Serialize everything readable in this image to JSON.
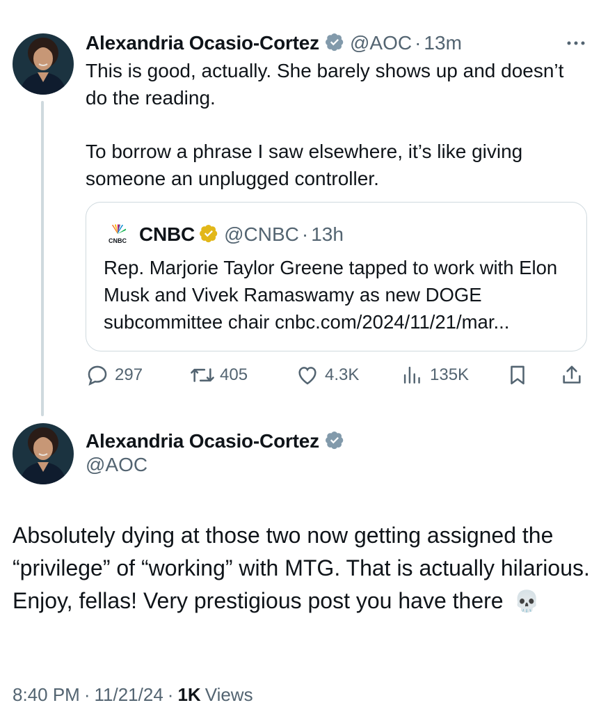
{
  "reply": {
    "author_name": "Alexandria Ocasio-Cortez",
    "handle": "@AOC",
    "separator": "·",
    "time": "13m",
    "text_p1": "This is good, actually. She barely shows up and doesn’t do the reading.",
    "text_p2": "To borrow a phrase I saw elsewhere, it’s like giving someone an unplugged controller.",
    "more_icon": "more-icon",
    "quote": {
      "source_logo_text": "CNBC",
      "author_name": "CNBC",
      "handle": "@CNBC",
      "separator": "·",
      "time": "13h",
      "text": "Rep. Marjorie Taylor Greene tapped to work with Elon Musk and Vivek Ramaswamy as new DOGE subcommittee chair cnbc.com/2024/11/21/mar..."
    },
    "actions": {
      "replies": "297",
      "reposts": "405",
      "likes": "4.3K",
      "views": "135K"
    }
  },
  "main": {
    "author_name": "Alexandria Ocasio-Cortez",
    "handle": "@AOC",
    "text": "Absolutely dying at those two now getting assigned the “privilege” of “working” with MTG. That is actually hilarious. Enjoy, fellas! Very prestigious post you have there",
    "emoji": "💀",
    "time": "8:40 PM",
    "dot": "·",
    "date": "11/21/24",
    "views_count": "1K",
    "views_label": "Views"
  },
  "colors": {
    "verified_blue": "#829aab",
    "verified_gold": "#e2b719",
    "secondary_text": "#536471",
    "border": "#cfd9de"
  }
}
